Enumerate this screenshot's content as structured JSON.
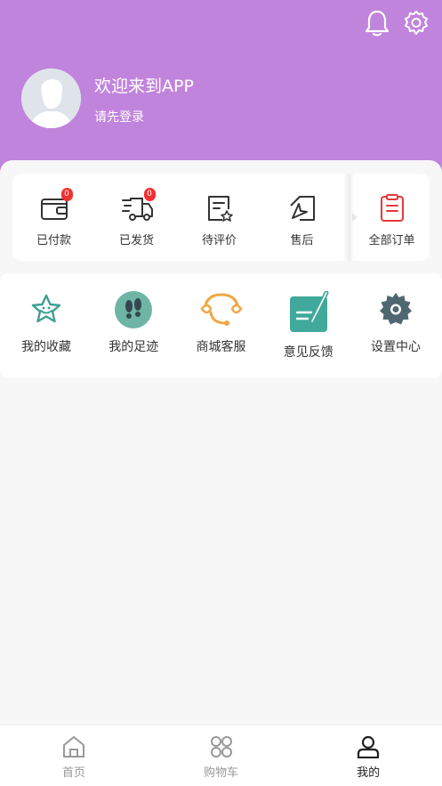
{
  "header": {
    "welcome": "欢迎来到APP",
    "login_prompt": "请先登录",
    "bg_color": "#c184dc"
  },
  "orders": {
    "items": [
      {
        "label": "已付款",
        "icon": "wallet-icon",
        "badge": "0"
      },
      {
        "label": "已发货",
        "icon": "truck-icon",
        "badge": "0"
      },
      {
        "label": "待评价",
        "icon": "review-icon"
      },
      {
        "label": "售后",
        "icon": "after-sale-icon"
      }
    ],
    "all_label": "全部订单"
  },
  "services": [
    {
      "label": "我的收藏",
      "icon": "star-icon"
    },
    {
      "label": "我的足迹",
      "icon": "footprint-icon"
    },
    {
      "label": "商城客服",
      "icon": "headset-icon"
    },
    {
      "label": "意见反馈",
      "icon": "feedback-icon"
    },
    {
      "label": "设置中心",
      "icon": "gear-icon"
    }
  ],
  "tabbar": [
    {
      "label": "首页",
      "icon": "home-icon"
    },
    {
      "label": "购物车",
      "icon": "cart-icon"
    },
    {
      "label": "我的",
      "icon": "user-icon",
      "active": true
    }
  ]
}
